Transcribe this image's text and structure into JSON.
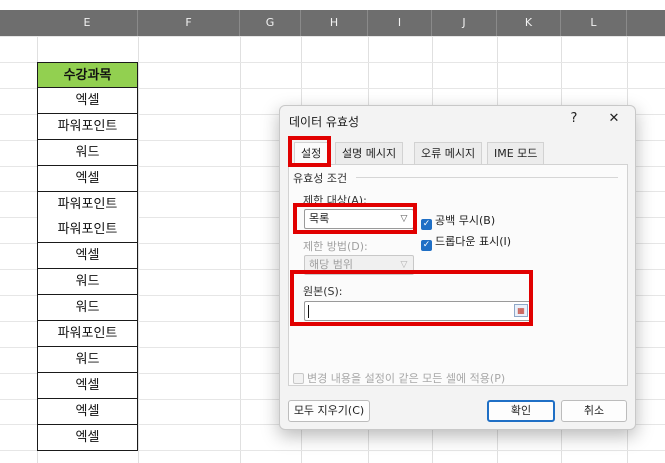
{
  "sheet": {
    "columns": [
      "E",
      "F",
      "G",
      "H",
      "I",
      "J",
      "K",
      "L"
    ],
    "header_cell": "수강과목",
    "rows": [
      "엑셀",
      "파워포인트",
      "워드",
      "엑셀",
      "파워포인트",
      "파워포인트",
      "엑셀",
      "워드",
      "워드",
      "파워포인트",
      "워드",
      "엑셀",
      "엑셀",
      "엑셀"
    ]
  },
  "dialog": {
    "title": "데이터 유효성",
    "help_label": "?",
    "close_label": "✕",
    "tabs": [
      {
        "label": "설정"
      },
      {
        "label": "설명 메시지"
      },
      {
        "label": "오류 메시지"
      },
      {
        "label": "IME 모드"
      }
    ],
    "criteria_label": "유효성 조건",
    "allow_label": "제한 대상(A):",
    "allow_value": "목록",
    "ignore_blank_label": "공백 무시(B)",
    "in_cell_dropdown_label": "드롭다운 표시(I)",
    "data_label": "제한 방법(D):",
    "data_value": "해당 범위",
    "source_label": "원본(S):",
    "source_value": "",
    "apply_all_label": "변경 내용을 설정이 같은 모든 셀에 적용(P)",
    "clear_all_label": "모두 지우기(C)",
    "ok_label": "확인",
    "cancel_label": "취소"
  },
  "colors": {
    "header_fill": "#92d050",
    "highlight": "#e10000",
    "accent": "#1f6fc5"
  }
}
